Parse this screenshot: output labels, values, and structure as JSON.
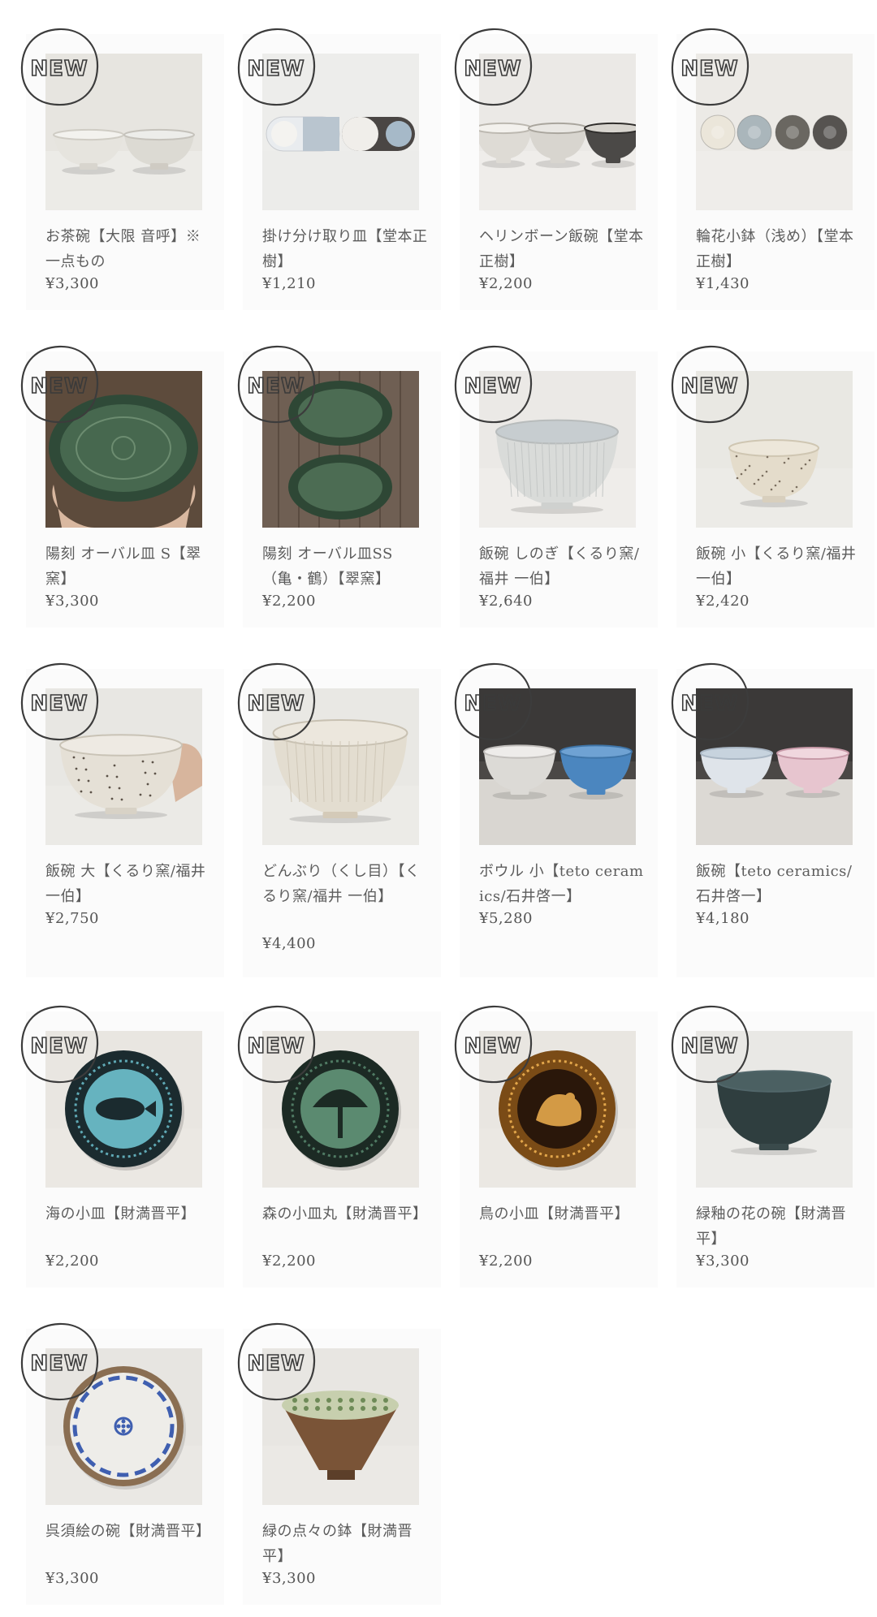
{
  "badge_text": "NEW",
  "products": [
    {
      "name": "お茶碗【大限 音呼】※一点もの",
      "price": "¥3,300"
    },
    {
      "name": "掛け分け取り皿【堂本正樹】",
      "price": "¥1,210"
    },
    {
      "name": "ヘリンボーン飯碗【堂本正樹】",
      "price": "¥2,200"
    },
    {
      "name": "輪花小鉢（浅め）【堂本正樹】",
      "price": "¥1,430"
    },
    {
      "name": "陽刻 オーバル皿 S【翠窯】",
      "price": "¥3,300"
    },
    {
      "name": "陽刻 オーバル皿SS（亀・鶴）【翠窯】",
      "price": "¥2,200"
    },
    {
      "name": "飯碗 しのぎ【くるり窯/福井 一伯】",
      "price": "¥2,640"
    },
    {
      "name": "飯碗 小【くるり窯/福井 一伯】",
      "price": "¥2,420"
    },
    {
      "name": "飯碗 大【くるり窯/福井 一伯】",
      "price": "¥2,750"
    },
    {
      "name": "どんぶり（くし目）【くるり窯/福井 一伯】",
      "price": "¥4,400"
    },
    {
      "name": "ボウル 小【teto ceramics/石井啓一】",
      "price": "¥5,280"
    },
    {
      "name": "飯碗【teto ceramics/石井啓一】",
      "price": "¥4,180"
    },
    {
      "name": "海の小皿【財満晋平】",
      "price": "¥2,200"
    },
    {
      "name": "森の小皿丸【財満晋平】",
      "price": "¥2,200"
    },
    {
      "name": "鳥の小皿【財満晋平】",
      "price": "¥2,200"
    },
    {
      "name": "緑釉の花の碗【財満晋平】",
      "price": "¥3,300"
    },
    {
      "name": "呉須絵の碗【財満晋平】",
      "price": "¥3,300"
    },
    {
      "name": "緑の点々の鉢【財満晋平】",
      "price": "¥3,300"
    }
  ]
}
